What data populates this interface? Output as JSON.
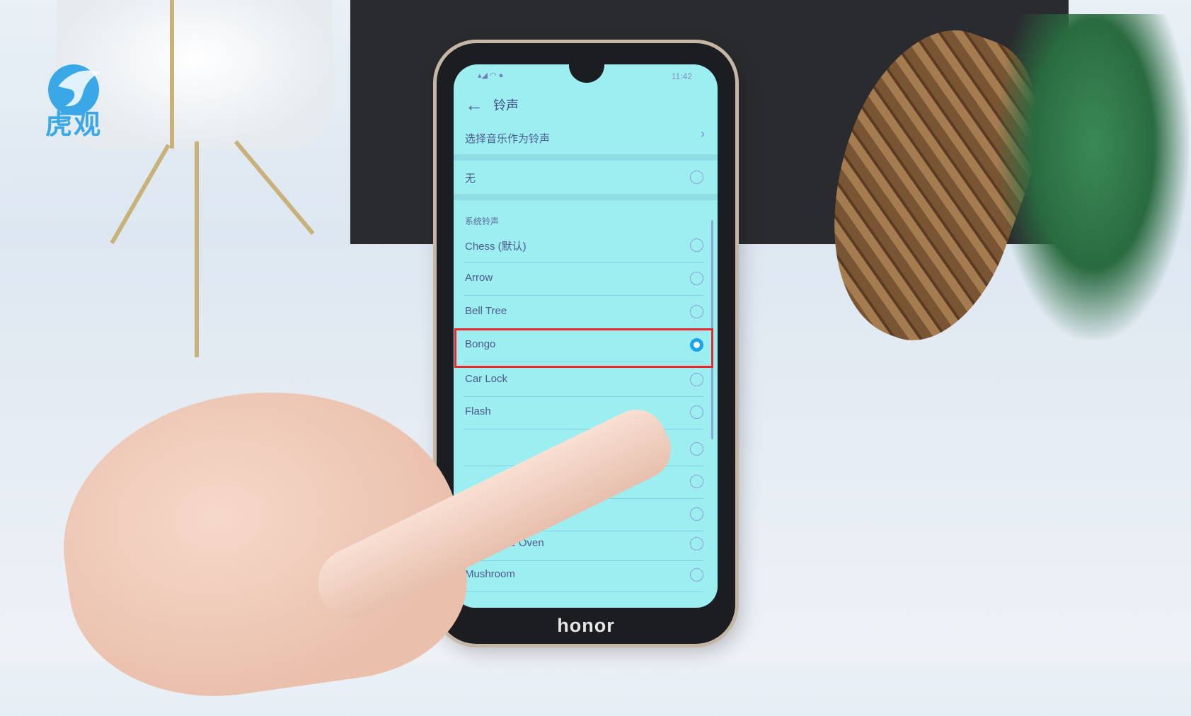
{
  "watermark": {
    "logo_text": "虎观"
  },
  "phone": {
    "brand": "honor"
  },
  "status_bar": {
    "left_icons": "signal wifi message",
    "time": "11:42"
  },
  "header": {
    "back_icon": "arrow-left-icon",
    "title": "铃声"
  },
  "choose_music": {
    "label": "选择音乐作为铃声",
    "icon": "chevron-right-icon"
  },
  "none_option": {
    "label": "无",
    "selected": false
  },
  "section_title": "系统铃声",
  "ringtones": [
    {
      "label": "Chess (默认)",
      "selected": false
    },
    {
      "label": "Arrow",
      "selected": false
    },
    {
      "label": "Bell Tree",
      "selected": false
    },
    {
      "label": "Bongo",
      "selected": true
    },
    {
      "label": "Car Lock",
      "selected": false
    },
    {
      "label": "Flash",
      "selected": false
    },
    {
      "label": "",
      "selected": false
    },
    {
      "label": "",
      "selected": false
    },
    {
      "label": "",
      "selected": false
    },
    {
      "label": "Microwave Oven",
      "selected": false
    },
    {
      "label": "Mushroom",
      "selected": false
    }
  ],
  "colors": {
    "screen_bg": "#9deef0",
    "selected_radio": "#1aa5e8",
    "highlight_box": "#e8262c",
    "text": "#4a5a8c"
  }
}
